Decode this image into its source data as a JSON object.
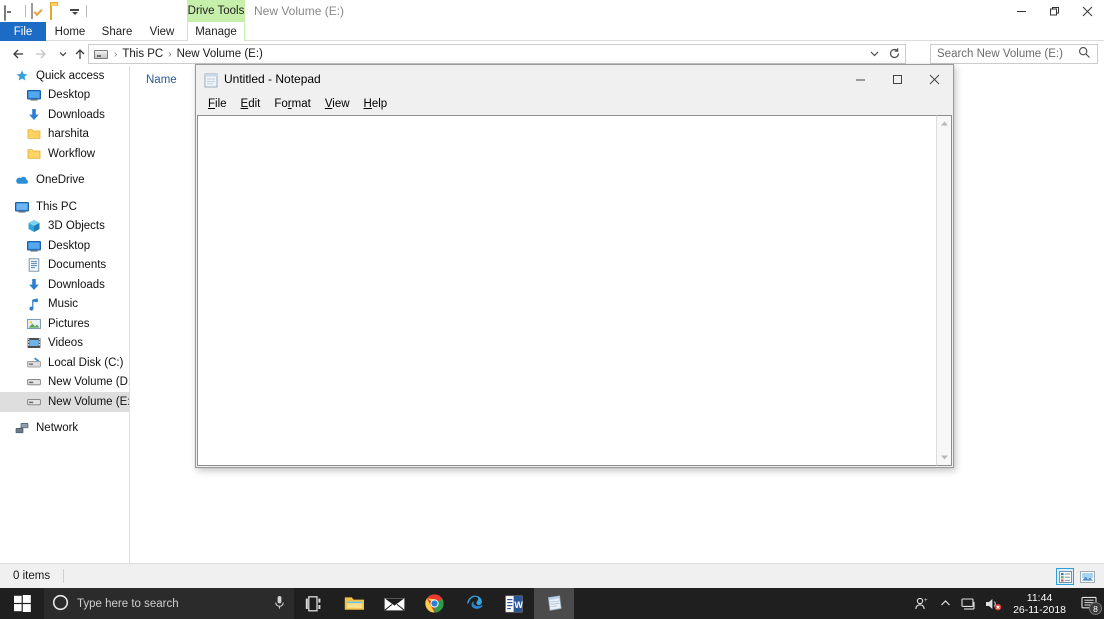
{
  "explorer": {
    "window_title": "New Volume (E:)",
    "contextual_tab_group": "Drive Tools",
    "quick_access": [
      {
        "name": "drive-icon",
        "label": "Drive"
      },
      {
        "name": "properties-icon",
        "label": "Properties"
      },
      {
        "name": "new-folder-icon",
        "label": "New folder"
      },
      {
        "name": "customize-caret-icon",
        "label": "Customize Quick Access Toolbar"
      }
    ],
    "window_controls": {
      "minimize": "Minimize",
      "maximize": "Restore Down",
      "close": "Close"
    },
    "ribbon_tabs": [
      {
        "label": "File",
        "selected": false
      },
      {
        "label": "Home",
        "selected": false
      },
      {
        "label": "Share",
        "selected": false
      },
      {
        "label": "View",
        "selected": false
      },
      {
        "label": "Manage",
        "selected": true
      }
    ],
    "help_label": "?",
    "navigation": {
      "back": "Back",
      "forward": "Forward",
      "recent": "Recent locations",
      "up": "Up"
    },
    "breadcrumb": [
      "This PC",
      "New Volume (E:)"
    ],
    "search": {
      "placeholder": "Search New Volume (E:)"
    },
    "column_header": "Name",
    "status_text": "0 items",
    "view_buttons": [
      {
        "name": "details-view-button",
        "label": "Details view",
        "active": true
      },
      {
        "name": "large-icons-view-button",
        "label": "Large icons view",
        "active": false
      }
    ],
    "nav_pane": [
      {
        "label": "Quick access",
        "icon": "pin-icon",
        "indent": false,
        "selected": false
      },
      {
        "label": "Desktop",
        "icon": "desktop-icon",
        "indent": true,
        "selected": false
      },
      {
        "label": "Downloads",
        "icon": "downloads-icon",
        "indent": true,
        "selected": false
      },
      {
        "label": "harshita",
        "icon": "folder-icon",
        "indent": true,
        "selected": false
      },
      {
        "label": "Workflow",
        "icon": "folder-icon",
        "indent": true,
        "selected": false
      },
      {
        "label": "OneDrive",
        "icon": "onedrive-icon",
        "indent": false,
        "selected": false
      },
      {
        "label": "This PC",
        "icon": "this-pc-icon",
        "indent": false,
        "selected": false
      },
      {
        "label": "3D Objects",
        "icon": "3d-objects-icon",
        "indent": true,
        "selected": false
      },
      {
        "label": "Desktop",
        "icon": "desktop-icon",
        "indent": true,
        "selected": false
      },
      {
        "label": "Documents",
        "icon": "documents-icon",
        "indent": true,
        "selected": false
      },
      {
        "label": "Downloads",
        "icon": "downloads-icon",
        "indent": true,
        "selected": false
      },
      {
        "label": "Music",
        "icon": "music-icon",
        "indent": true,
        "selected": false
      },
      {
        "label": "Pictures",
        "icon": "pictures-icon",
        "indent": true,
        "selected": false
      },
      {
        "label": "Videos",
        "icon": "videos-icon",
        "indent": true,
        "selected": false
      },
      {
        "label": "Local Disk (C:)",
        "icon": "local-disk-icon",
        "indent": true,
        "selected": false
      },
      {
        "label": "New Volume (D:)",
        "icon": "drive-icon",
        "indent": true,
        "selected": false
      },
      {
        "label": "New Volume (E:)",
        "icon": "drive-icon",
        "indent": true,
        "selected": true
      },
      {
        "label": "Network",
        "icon": "network-icon",
        "indent": false,
        "selected": false
      }
    ]
  },
  "notepad": {
    "title": "Untitled - Notepad",
    "icon": "notepad-icon",
    "menu": [
      {
        "label": "File",
        "accel": "F",
        "rest": "ile"
      },
      {
        "label": "Edit",
        "accel": "E",
        "rest": "dit"
      },
      {
        "label": "Format",
        "pre": "Fo",
        "accel": "r",
        "rest": "mat"
      },
      {
        "label": "View",
        "accel": "V",
        "rest": "iew"
      },
      {
        "label": "Help",
        "accel": "H",
        "rest": "elp"
      }
    ],
    "text_content": "",
    "window_controls": {
      "minimize": "Minimize",
      "maximize": "Maximize",
      "close": "Close"
    }
  },
  "taskbar": {
    "start_label": "Start",
    "search_placeholder": "Type here to search",
    "cortana_icon": "cortana-circle-icon",
    "mic_icon": "microphone-icon",
    "items": [
      {
        "name": "task-view-button",
        "label": "Task View",
        "active": false
      },
      {
        "name": "file-explorer-button",
        "label": "File Explorer",
        "active": false
      },
      {
        "name": "mail-button",
        "label": "Mail",
        "active": false
      },
      {
        "name": "chrome-button",
        "label": "Google Chrome",
        "active": false
      },
      {
        "name": "edge-button",
        "label": "Microsoft Edge",
        "active": false
      },
      {
        "name": "word-button",
        "label": "Microsoft Word",
        "active": false
      },
      {
        "name": "notepad-button",
        "label": "Notepad",
        "active": true
      }
    ],
    "tray": [
      {
        "name": "people-icon",
        "label": "People"
      },
      {
        "name": "show-hidden-icons-chevron",
        "label": "Show hidden icons"
      },
      {
        "name": "network-tray-icon",
        "label": "Network"
      },
      {
        "name": "volume-muted-icon",
        "label": "Volume muted"
      }
    ],
    "clock": {
      "time": "11:44",
      "date": "26-11-2018"
    },
    "action_center": {
      "name": "action-center-icon",
      "badge": "8"
    }
  },
  "colors": {
    "accent_blue": "#1c6bc4",
    "contextual_green": "#c6efac",
    "taskbar": "#1f1f1f",
    "selection_gray": "#dedede",
    "column_header_blue": "#2a5899"
  }
}
